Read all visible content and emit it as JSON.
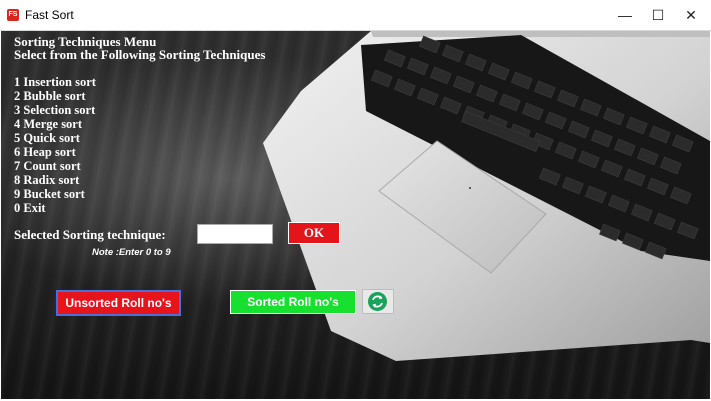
{
  "window": {
    "title": "Fast Sort",
    "icon": "app-icon",
    "icon_text": "FS",
    "minimize_label": "—",
    "maximize_label": "☐",
    "close_label": "✕"
  },
  "menu": {
    "heading_line1": "Sorting Techniques Menu",
    "heading_line2": "Select from the Following Sorting Techniques",
    "items": [
      "1 Insertion sort",
      "2 Bubble sort",
      "3 Selection sort",
      "4 Merge sort",
      "5 Quick sort",
      "6 Heap sort",
      "7 Count sort",
      "8 Radix sort",
      "9  Bucket sort",
      "0  Exit"
    ]
  },
  "selection": {
    "label": "Selected Sorting technique:",
    "value": "",
    "ok_label": "OK",
    "note": "Note :Enter 0 to 9"
  },
  "buttons": {
    "unsorted_label": "Unsorted Roll no's",
    "sorted_label": "Sorted Roll no's",
    "refresh_icon": "refresh-icon"
  },
  "colors": {
    "ok_button": "#e4141b",
    "unsorted_button": "#e8141c",
    "sorted_button": "#17e02e",
    "refresh_icon": "#1aa35a"
  }
}
